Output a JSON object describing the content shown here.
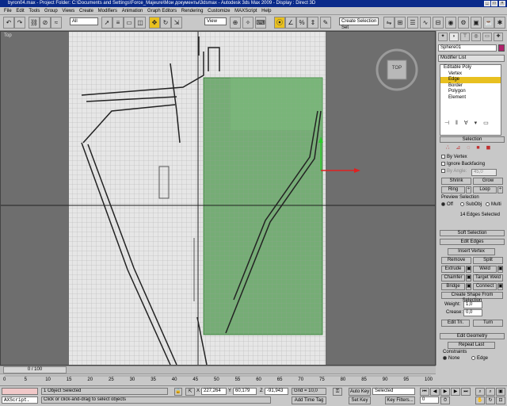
{
  "window": {
    "title": "byron04.max    - Project Folder: C:\\Documents and Settings\\Force_Majeure\\Мои документы\\3dsmax    - Autodesk 3ds Max  2009      - Display : Direct 3D"
  },
  "menu": [
    "File",
    "Edit",
    "Tools",
    "Group",
    "Views",
    "Create",
    "Modifiers",
    "Animation",
    "Graph Editors",
    "Rendering",
    "Customize",
    "MAXScript",
    "Help"
  ],
  "toolbar": {
    "selection_filter": "All",
    "reference_coord": "View",
    "named_selection_placeholder": "Create Selection Set"
  },
  "viewport": {
    "label": "Top",
    "viewcube_label": "TOP"
  },
  "command_panel": {
    "object_name": "Sphere01",
    "modifier_list": "Modifier List",
    "stack": {
      "root": "Editable Poly",
      "items": [
        "Vertex",
        "Edge",
        "Border",
        "Polygon",
        "Element"
      ],
      "selected": "Edge"
    },
    "selection": {
      "title": "Selection",
      "by_vertex": "By Vertex",
      "ignore_backfacing": "Ignore Backfacing",
      "by_angle": "By Angle:",
      "by_angle_value": "45,0",
      "shrink": "Shrink",
      "grow": "Grow",
      "ring": "Ring",
      "loop": "Loop",
      "preview_label": "Preview Selection",
      "preview_off": "Off",
      "preview_subobj": "SubObj",
      "preview_multi": "Multi",
      "status": "14 Edges Selected"
    },
    "soft_selection": {
      "title": "Soft Selection"
    },
    "edit_edges": {
      "title": "Edit Edges",
      "insert_vertex": "Insert Vertex",
      "remove": "Remove",
      "split": "Split",
      "extrude": "Extrude",
      "weld": "Weld",
      "chamfer": "Chamfer",
      "target_weld": "Target Weld",
      "bridge": "Bridge",
      "connect": "Connect",
      "create_shape": "Create Shape From Selection",
      "weight_label": "Weight:",
      "weight_value": "1,0",
      "crease_label": "Crease:",
      "crease_value": "0,0",
      "edit_tri": "Edit Tri.",
      "turn": "Turn"
    },
    "edit_geometry": {
      "title": "Edit Geometry",
      "repeat_last": "Repeat Last",
      "constraints_label": "Constraints",
      "none": "None",
      "edge": "Edge",
      "face": "Face",
      "normal": "Normal",
      "preserve_uvs": "Preserve UVs"
    }
  },
  "timeline": {
    "frame": "0 / 100",
    "ticks": [
      "0",
      "5",
      "10",
      "15",
      "20",
      "25",
      "30",
      "35",
      "40",
      "45",
      "50",
      "55",
      "60",
      "65",
      "70",
      "75",
      "80",
      "85",
      "90",
      "95",
      "100"
    ]
  },
  "status": {
    "maxscript": "AXScript.",
    "selected_count": "1 Object Selected",
    "prompt": "Click or click-and-drag to select objects",
    "x_label": "X",
    "x_value": "227,264",
    "y_label": "Y",
    "y_value": "60,179",
    "z_label": "Z",
    "z_value": "-91,943",
    "grid": "Grid = 10,0",
    "add_time_tag": "Add Time Tag",
    "auto_key": "Auto Key",
    "set_key": "Set Key",
    "selected_dropdown": "Selected",
    "key_filters": "Key Filters...",
    "frame_number": "0"
  },
  "colors": {
    "title_bar": "#0a2a8a",
    "active_yellow": "#e8c020",
    "selection_green": "#2e8a2e",
    "viewport_bg": "#6e6e6e",
    "grid_paper": "#e6e6e6"
  }
}
